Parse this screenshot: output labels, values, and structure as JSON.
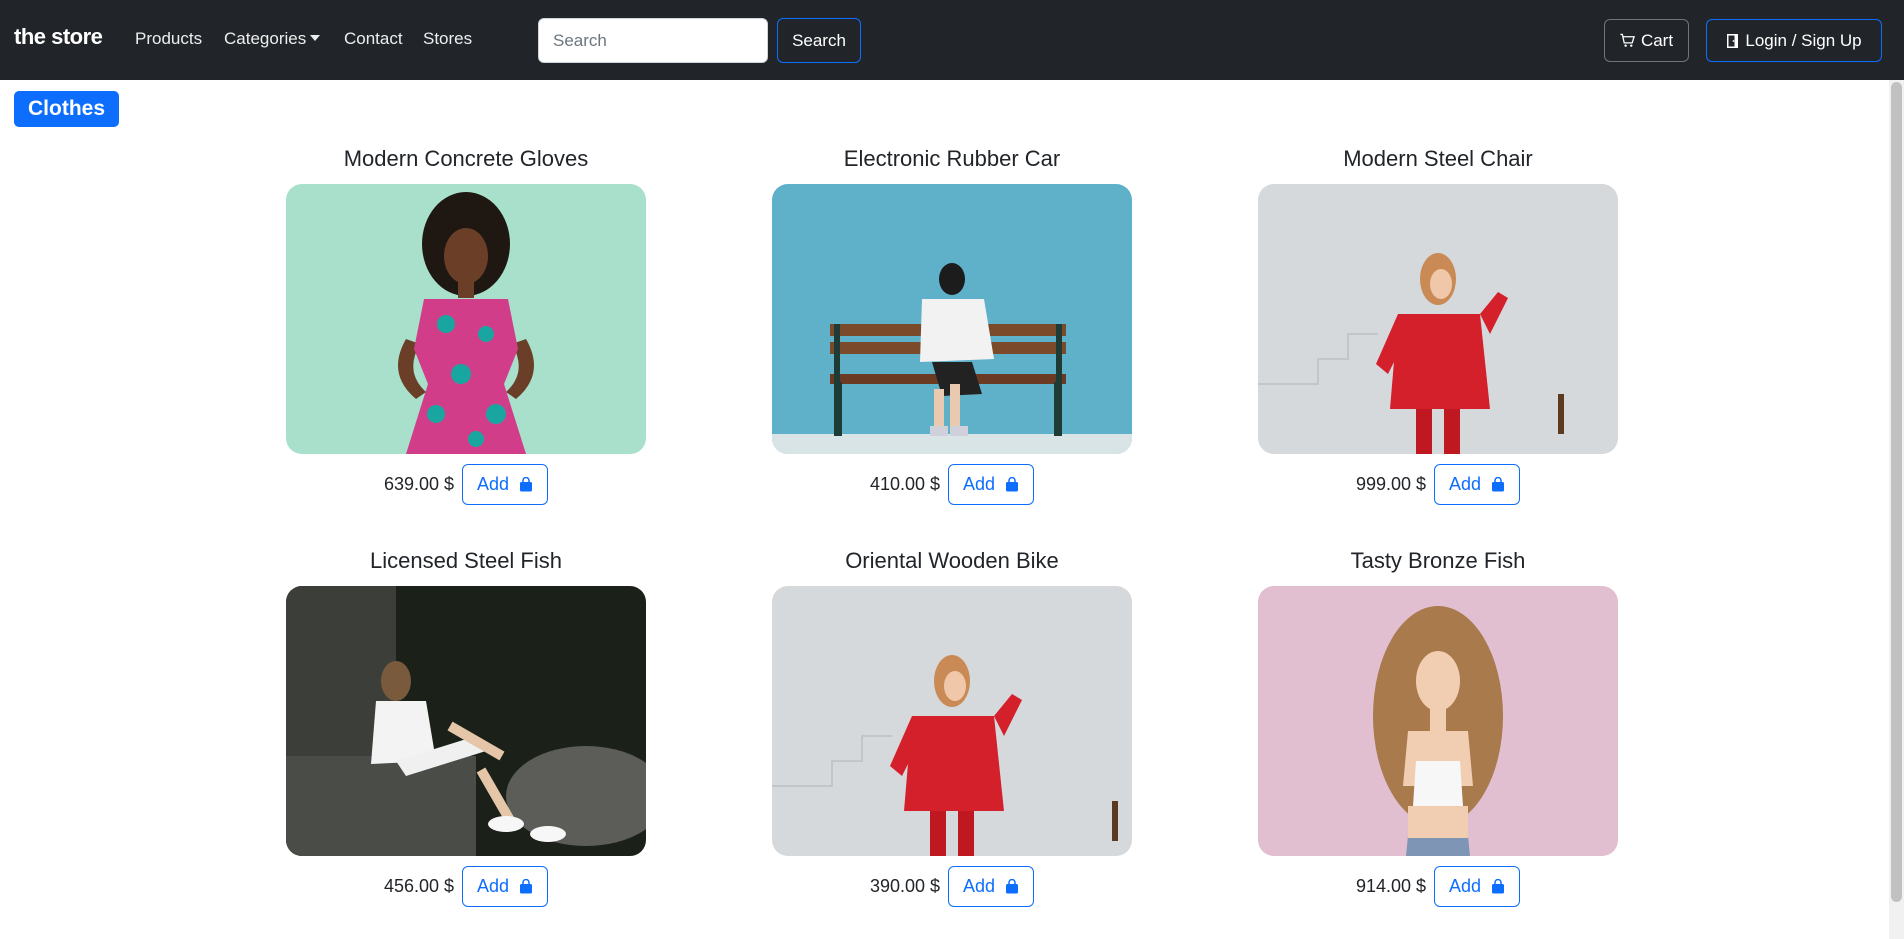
{
  "navbar": {
    "brand": "the store",
    "links": [
      "Products",
      "Categories",
      "Contact",
      "Stores"
    ],
    "search_placeholder": "Search",
    "search_button": "Search",
    "cart_label": "Cart",
    "login_label": "Login / Sign Up",
    "cart_icon": "cart-icon",
    "login_icon": "door-icon"
  },
  "category": {
    "label": "Clothes"
  },
  "products": [
    {
      "name": "Modern Concrete Gloves",
      "price": "639.00 $",
      "add_label": "Add",
      "image": "woman-floral-dress-mint-wall"
    },
    {
      "name": "Electronic Rubber Car",
      "price": "410.00 $",
      "add_label": "Add",
      "image": "woman-on-bench-blue-wall"
    },
    {
      "name": "Modern Steel Chair",
      "price": "999.00 $",
      "add_label": "Add",
      "image": "woman-red-sweater-white-wall"
    },
    {
      "name": "Licensed Steel Fish",
      "price": "456.00 $",
      "add_label": "Add",
      "image": "woman-sitting-stone-dark"
    },
    {
      "name": "Oriental Wooden Bike",
      "price": "390.00 $",
      "add_label": "Add",
      "image": "woman-red-sweater-white-wall"
    },
    {
      "name": "Tasty Bronze Fish",
      "price": "914.00 $",
      "add_label": "Add",
      "image": "woman-long-hair-pink-wall"
    }
  ],
  "colors": {
    "navbar_bg": "#212529",
    "primary": "#0d6efd",
    "secondary": "#6c757d"
  }
}
